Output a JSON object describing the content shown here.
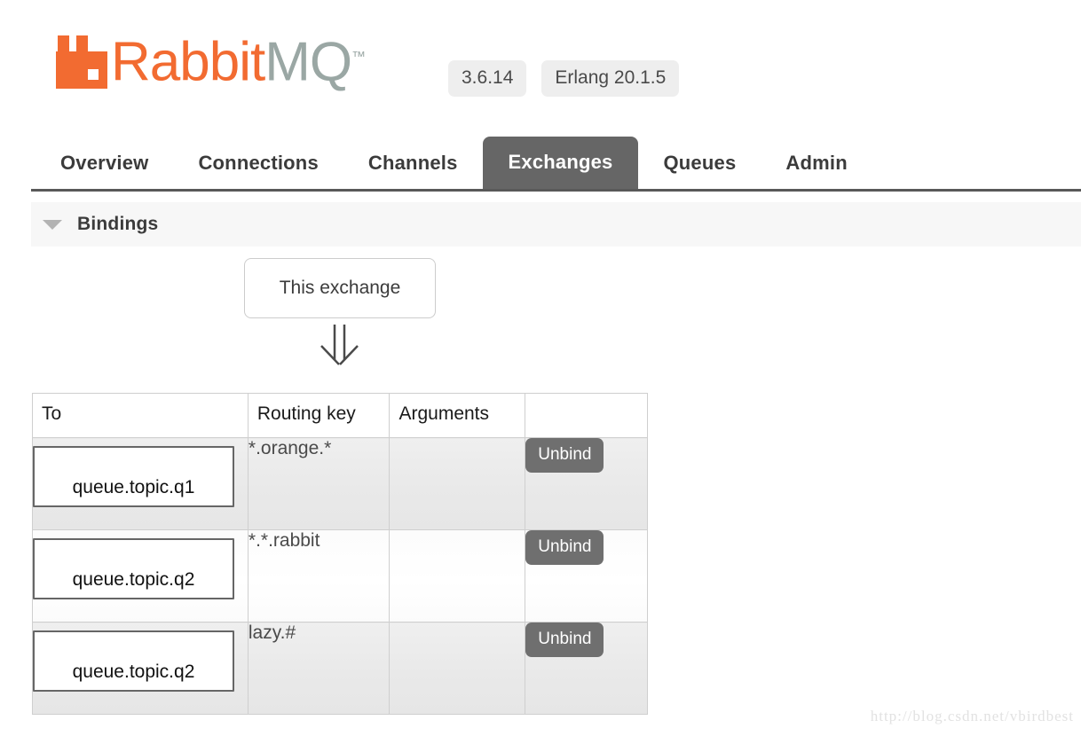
{
  "app": {
    "brand_rabbit": "Rabbit",
    "brand_mq": "MQ",
    "brand_tm": "™",
    "server_version": "3.6.14",
    "erlang_version": "Erlang 20.1.5",
    "accent_color": "#f26b31",
    "logo_gray": "#9aa7a4",
    "active_tab_color": "#666666",
    "button_color": "#6f6f6f"
  },
  "nav": {
    "tabs": [
      {
        "label": "Overview",
        "active": false
      },
      {
        "label": "Connections",
        "active": false
      },
      {
        "label": "Channels",
        "active": false
      },
      {
        "label": "Exchanges",
        "active": true
      },
      {
        "label": "Queues",
        "active": false
      },
      {
        "label": "Admin",
        "active": false
      }
    ]
  },
  "bindings_section": {
    "title": "Bindings",
    "caret_icon": "chevron-down-icon",
    "source_node_label": "This exchange",
    "arrow_icon": "double-down-arrow-icon"
  },
  "bindings_table": {
    "columns": [
      "To",
      "Routing key",
      "Arguments",
      ""
    ],
    "rows": [
      {
        "to": "queue.topic.q1",
        "routing_key": "*.orange.*",
        "arguments": "",
        "action": "Unbind"
      },
      {
        "to": "queue.topic.q2",
        "routing_key": "*.*.rabbit",
        "arguments": "",
        "action": "Unbind"
      },
      {
        "to": "queue.topic.q2",
        "routing_key": "lazy.#",
        "arguments": "",
        "action": "Unbind"
      }
    ]
  },
  "watermark": {
    "text": "http://blog.csdn.net/vbirdbest"
  }
}
